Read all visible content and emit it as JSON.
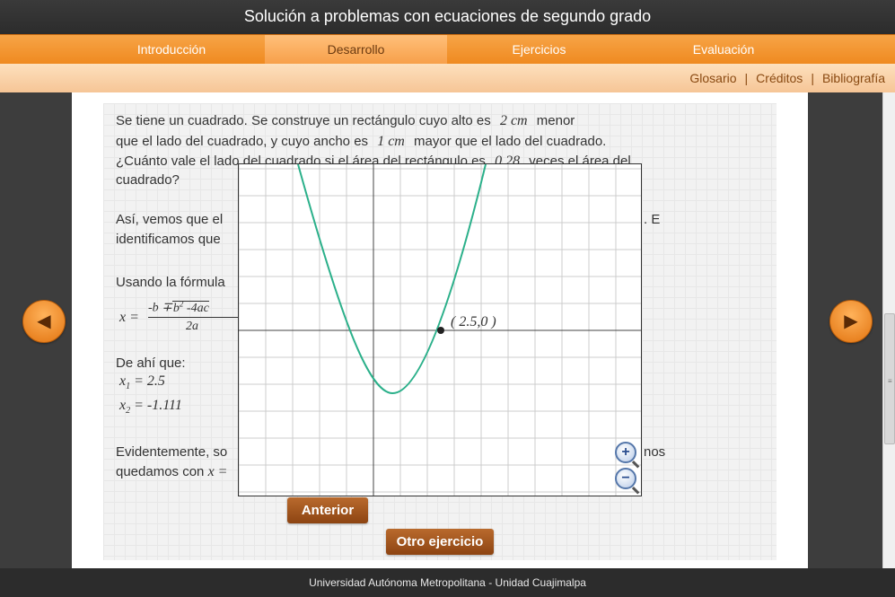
{
  "app": {
    "title": "Solución a problemas con ecuaciones de segundo grado"
  },
  "tabs": [
    {
      "label": "Introducción"
    },
    {
      "label": "Desarrollo"
    },
    {
      "label": "Ejercicios"
    },
    {
      "label": "Evaluación"
    }
  ],
  "links": [
    {
      "label": "Glosario"
    },
    {
      "label": "Créditos"
    },
    {
      "label": "Bibliografía"
    }
  ],
  "link_separator": "|",
  "content": {
    "p1": {
      "l1a": "Se tiene un cuadrado. Se construye un rectángulo cuyo alto es",
      "l1m": "2 cm",
      "l1b": "menor",
      "l2a": "que el lado del cuadrado, y cuyo ancho es",
      "l2m": "1 cm",
      "l2b": "mayor que el lado del cuadrado.",
      "l3a": "¿Cuánto vale el lado del cuadrado si el área del rectángulo es",
      "l3m": "0.28",
      "l3b": "veces el área del",
      "l4": "cuadrado?"
    },
    "p2": {
      "l1a": "Así, vemos que el",
      "l1b": ". E",
      "l2": "identificamos que"
    },
    "formula_intro": "Usando la fórmula",
    "formula": {
      "lhs": "x =",
      "num_a": "-b ∓",
      "num_rad": "b",
      "num_exp": "2",
      "num_rest": " -4ac",
      "den": "2a"
    },
    "de_ahi": "De ahí que:",
    "x1": {
      "var": "x",
      "sub": "1",
      "rest": "= 2.5"
    },
    "x2": {
      "var": "x",
      "sub": "2",
      "rest": "= -1.111"
    },
    "p3": {
      "l1a": "Evidentemente, so",
      "l1b": "nos",
      "l2a": "quedamos con",
      "l2m": "x ="
    }
  },
  "graph": {
    "point_label": "( 2.5,0 )"
  },
  "buttons": {
    "prev": "Anterior",
    "other": "Otro ejercicio"
  },
  "footer": "Universidad Autónoma Metropolitana - Unidad Cuajimalpa",
  "icons": {
    "prev_arrow": "arrow-left-icon",
    "next_arrow": "arrow-right-icon",
    "zoom_in": "zoom-in-icon",
    "zoom_out": "zoom-out-icon"
  },
  "colors": {
    "accent": "#ef8a20",
    "curve": "#2bb08a",
    "button": "#9a4c18"
  }
}
